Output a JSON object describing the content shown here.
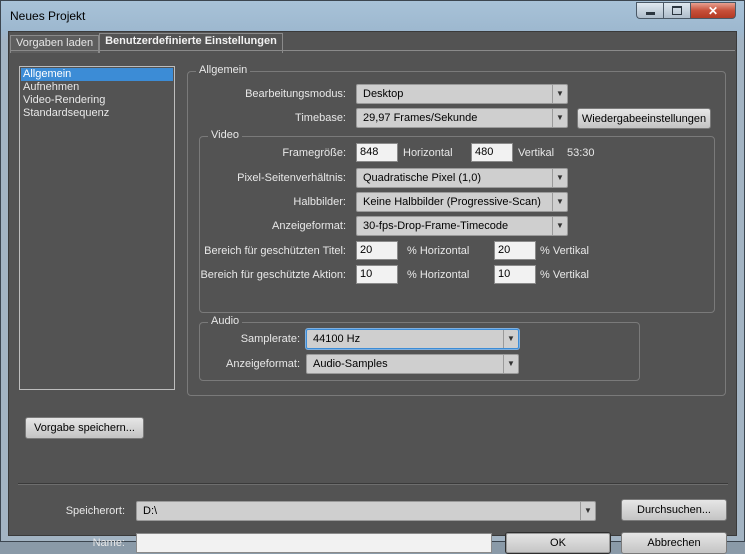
{
  "window": {
    "title": "Neues Projekt"
  },
  "tabs": [
    {
      "label": "Vorgaben laden"
    },
    {
      "label": "Benutzerdefinierte Einstellungen"
    }
  ],
  "nav": {
    "items": [
      {
        "label": "Allgemein"
      },
      {
        "label": "Aufnehmen"
      },
      {
        "label": "Video-Rendering"
      },
      {
        "label": "Standardsequenz"
      }
    ]
  },
  "general": {
    "group_label": "Allgemein",
    "edit_mode_label": "Bearbeitungsmodus:",
    "edit_mode_value": "Desktop",
    "timebase_label": "Timebase:",
    "timebase_value": "29,97 Frames/Sekunde",
    "playback_button": "Wiedergabeeinstellungen"
  },
  "video": {
    "group_label": "Video",
    "frame_size_label": "Framegröße:",
    "frame_width": "848",
    "horizontal_label": "Horizontal",
    "frame_height": "480",
    "vertical_label": "Vertikal",
    "aspect_ratio": "53:30",
    "pixel_aspect_label": "Pixel-Seitenverhältnis:",
    "pixel_aspect_value": "Quadratische Pixel (1,0)",
    "fields_label": "Halbbilder:",
    "fields_value": "Keine Halbbilder (Progressive-Scan)",
    "display_format_label": "Anzeigeformat:",
    "display_format_value": "30-fps-Drop-Frame-Timecode",
    "title_safe_label": "Bereich für geschützten Titel:",
    "title_safe_h": "20",
    "title_safe_v": "20",
    "action_safe_label": "Bereich für geschützte Aktion:",
    "action_safe_h": "10",
    "action_safe_v": "10",
    "pct_horizontal": "% Horizontal",
    "pct_vertical": "% Vertikal"
  },
  "audio": {
    "group_label": "Audio",
    "samplerate_label": "Samplerate:",
    "samplerate_value": "44100 Hz",
    "display_format_label": "Anzeigeformat:",
    "display_format_value": "Audio-Samples"
  },
  "save_preset_button": "Vorgabe speichern...",
  "location": {
    "label": "Speicherort:",
    "value": "D:\\",
    "browse_button": "Durchsuchen..."
  },
  "name": {
    "label": "Name:",
    "value": ""
  },
  "ok_button": "OK",
  "cancel_button": "Abbrechen",
  "colors": {
    "panel_bg": "#535353",
    "selection": "#3c8cd6",
    "close_button": "#c7503a"
  }
}
